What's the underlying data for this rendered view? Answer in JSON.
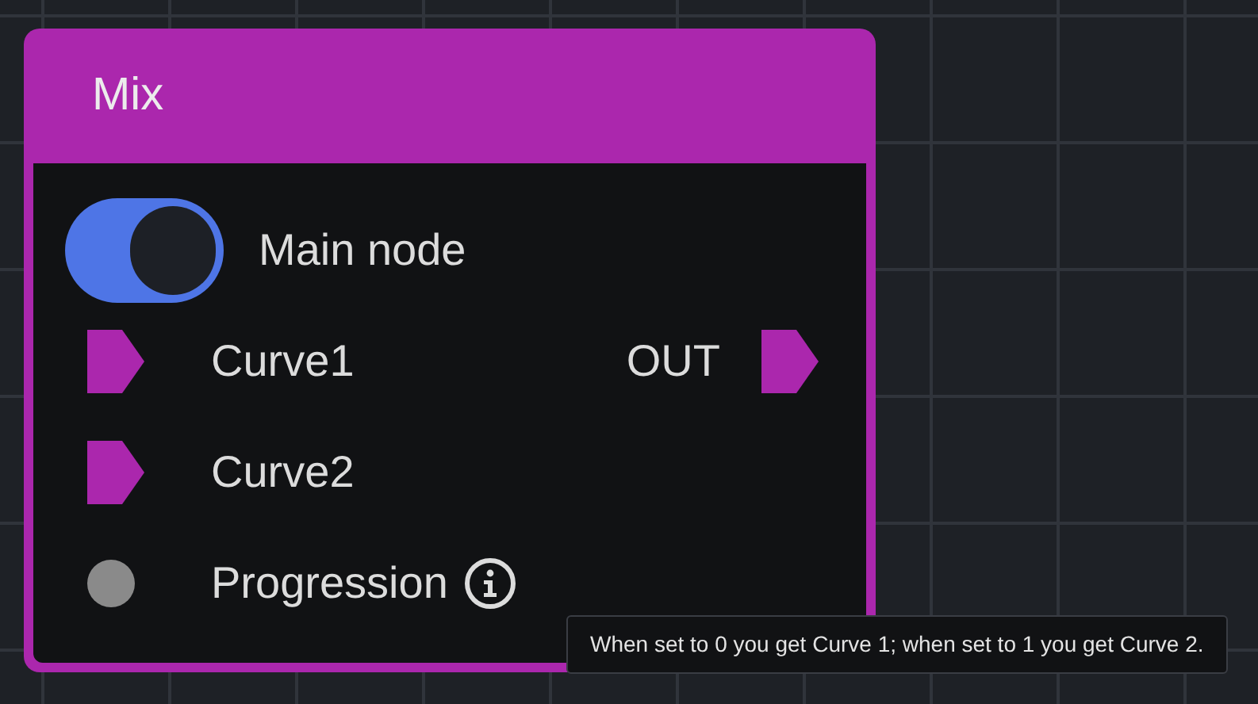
{
  "node": {
    "title": "Mix",
    "toggle": {
      "label": "Main node",
      "on": true
    },
    "inputs": [
      {
        "label": "Curve1",
        "kind": "port",
        "info": false
      },
      {
        "label": "Curve2",
        "kind": "port",
        "info": false
      },
      {
        "label": "Progression",
        "kind": "value",
        "info": true
      }
    ],
    "outputs": [
      {
        "label": "OUT",
        "kind": "port"
      }
    ]
  },
  "tooltip": {
    "text": "When set to 0 you get Curve 1; when set to 1 you get Curve 2."
  }
}
